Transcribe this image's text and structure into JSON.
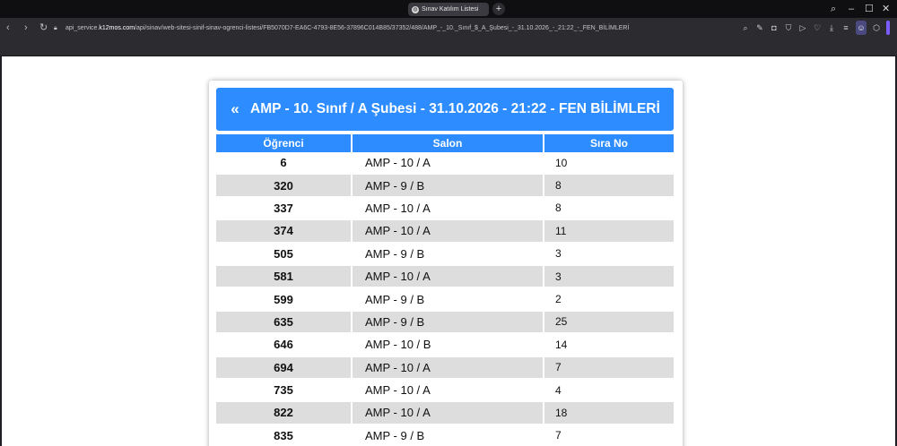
{
  "browser": {
    "tab_title": "Sınav Katılım Listesi",
    "new_tab_symbol": "+",
    "url_prefix": "api_service.",
    "url_host": "k12mos.com",
    "url_rest": "/api/sinav/web-sitesi-sinif-sinav-ogrenci-listesi/FB5070D7-EA6C-4793-8E56-37896C014B85/37352/488/AMP_-_10._Sınıf_$_A_Şubesi_-_31.10.2026_-_21:22_-_FEN_BİLİMLERİ"
  },
  "page": {
    "title": "AMP - 10. Sınıf / A Şubesi - 31.10.2026 - 21:22 - FEN BİLİMLERİ",
    "back_symbol": "«",
    "columns": [
      "Öğrenci",
      "Salon",
      "Sıra No"
    ],
    "rows": [
      {
        "student": "6",
        "room": "AMP - 10 / A",
        "seat": "10"
      },
      {
        "student": "320",
        "room": "AMP - 9 / B",
        "seat": "8"
      },
      {
        "student": "337",
        "room": "AMP - 10 / A",
        "seat": "8"
      },
      {
        "student": "374",
        "room": "AMP - 10 / A",
        "seat": "11"
      },
      {
        "student": "505",
        "room": "AMP - 9 / B",
        "seat": "3"
      },
      {
        "student": "581",
        "room": "AMP - 10 / A",
        "seat": "3"
      },
      {
        "student": "599",
        "room": "AMP - 9 / B",
        "seat": "2"
      },
      {
        "student": "635",
        "room": "AMP - 9 / B",
        "seat": "25"
      },
      {
        "student": "646",
        "room": "AMP - 10 / B",
        "seat": "14"
      },
      {
        "student": "694",
        "room": "AMP - 10 / A",
        "seat": "7"
      },
      {
        "student": "735",
        "room": "AMP - 10 / A",
        "seat": "4"
      },
      {
        "student": "822",
        "room": "AMP - 10 / A",
        "seat": "18"
      },
      {
        "student": "835",
        "room": "AMP - 9 / B",
        "seat": "7"
      }
    ]
  },
  "colors": {
    "accent": "#2d8cff",
    "row_alt": "#dddddd"
  }
}
